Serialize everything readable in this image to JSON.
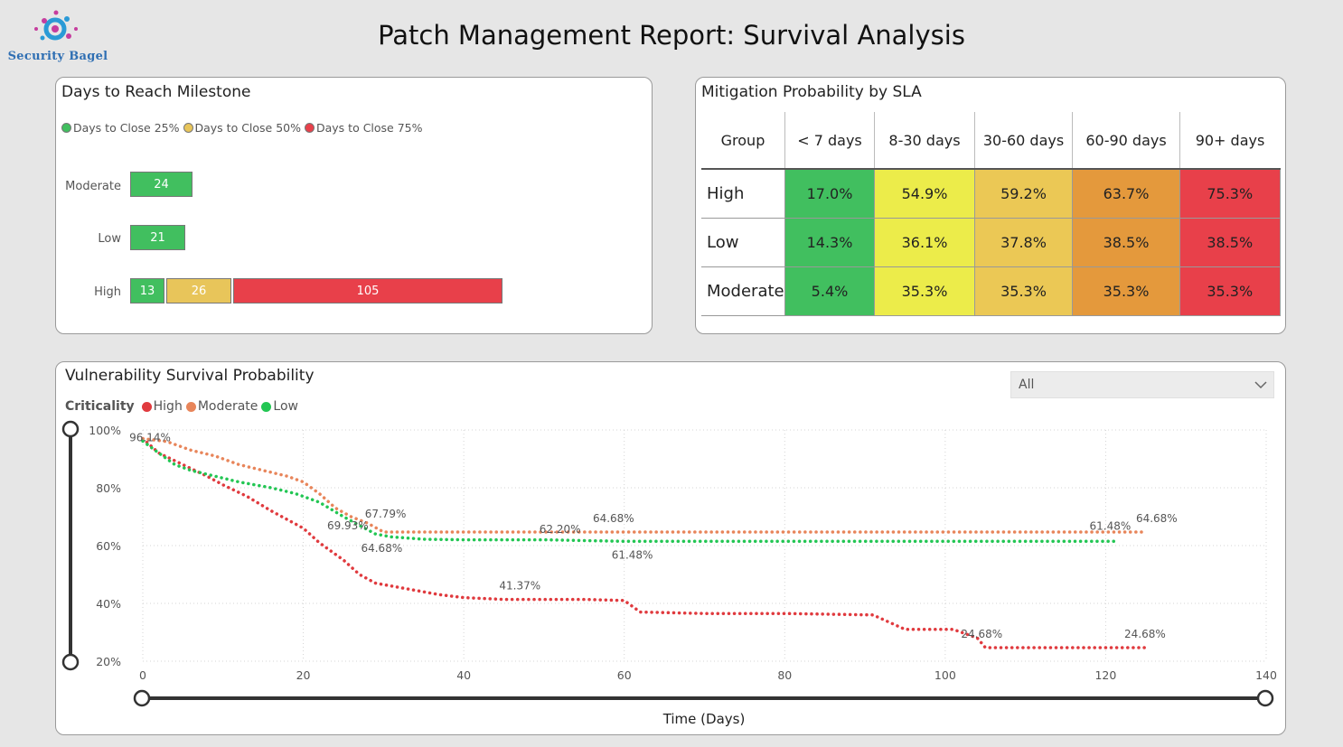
{
  "logo": {
    "text": "Security Bagel",
    "icon": "security-bagel-logo"
  },
  "page_title": "Patch Management Report: Survival Analysis",
  "milestone": {
    "title": "Days to Reach Milestone",
    "legend": [
      {
        "label": "Days to Close 25%",
        "color": "#41bf5f"
      },
      {
        "label": "Days to Close 50%",
        "color": "#e8c55a"
      },
      {
        "label": "Days to Close 75%",
        "color": "#e8404a"
      }
    ],
    "rows": [
      {
        "label": "Moderate",
        "values": [
          24
        ]
      },
      {
        "label": "Low",
        "values": [
          21
        ]
      },
      {
        "label": "High",
        "values": [
          13,
          26,
          105
        ]
      }
    ]
  },
  "sla": {
    "title": "Mitigation Probability by SLA",
    "columns": [
      "Group",
      "< 7 days",
      "8-30 days",
      "30-60 days",
      "60-90 days",
      "90+ days"
    ],
    "rows": [
      {
        "group": "High",
        "values": [
          "17.0%",
          "54.9%",
          "59.2%",
          "63.7%",
          "75.3%"
        ]
      },
      {
        "group": "Low",
        "values": [
          "14.3%",
          "36.1%",
          "37.8%",
          "38.5%",
          "38.5%"
        ]
      },
      {
        "group": "Moderate",
        "values": [
          "5.4%",
          "35.3%",
          "35.3%",
          "35.3%",
          "35.3%"
        ]
      }
    ],
    "column_colors": [
      "#41bf5f",
      "#ecec4a",
      "#ebc855",
      "#e4993c",
      "#e8404a"
    ]
  },
  "survival": {
    "title": "Vulnerability Survival Probability",
    "filter_value": "All",
    "legend_title": "Criticality",
    "legend": [
      {
        "label": "High",
        "color": "#e03a3e"
      },
      {
        "label": "Moderate",
        "color": "#e8855a"
      },
      {
        "label": "Low",
        "color": "#22c653"
      }
    ],
    "xlabel": "Time (Days)"
  },
  "chart_data": {
    "type": "line",
    "title": "Vulnerability Survival Probability",
    "xlabel": "Time (Days)",
    "ylabel": "",
    "xlim": [
      0,
      140
    ],
    "ylim": [
      20,
      100
    ],
    "x_ticks": [
      "0",
      "20",
      "40",
      "60",
      "80",
      "100",
      "120",
      "140"
    ],
    "y_ticks": [
      "20%",
      "40%",
      "60%",
      "80%",
      "100%"
    ],
    "grid": true,
    "legend_position": "top-left",
    "series": [
      {
        "name": "High",
        "color": "#e03a3e",
        "points": [
          [
            0,
            97
          ],
          [
            2,
            92
          ],
          [
            5,
            88
          ],
          [
            8,
            84
          ],
          [
            10,
            81
          ],
          [
            13,
            77
          ],
          [
            16,
            72
          ],
          [
            20,
            66
          ],
          [
            22,
            61
          ],
          [
            25,
            55
          ],
          [
            27,
            50
          ],
          [
            29,
            47
          ],
          [
            33,
            45
          ],
          [
            37,
            43
          ],
          [
            40,
            42
          ],
          [
            45,
            41.37
          ],
          [
            55,
            41.37
          ],
          [
            60,
            41
          ],
          [
            62,
            37
          ],
          [
            70,
            36.5
          ],
          [
            80,
            36.5
          ],
          [
            91,
            36
          ],
          [
            95,
            31
          ],
          [
            101,
            31
          ],
          [
            104,
            28
          ],
          [
            105,
            24.68
          ],
          [
            112,
            24.68
          ],
          [
            125,
            24.68
          ]
        ]
      },
      {
        "name": "Moderate",
        "color": "#e8855a",
        "points": [
          [
            0,
            97
          ],
          [
            3,
            96
          ],
          [
            6,
            93
          ],
          [
            9,
            91
          ],
          [
            12,
            88
          ],
          [
            15,
            86
          ],
          [
            18,
            84
          ],
          [
            20,
            82
          ],
          [
            22,
            78
          ],
          [
            24,
            73
          ],
          [
            26,
            69.93
          ],
          [
            28,
            67.79
          ],
          [
            30,
            64.68
          ],
          [
            40,
            64.68
          ],
          [
            50,
            64.68
          ],
          [
            55,
            64.68
          ],
          [
            62,
            64.68
          ],
          [
            80,
            64.68
          ],
          [
            100,
            64.68
          ],
          [
            120,
            64.68
          ],
          [
            125,
            64.68
          ]
        ]
      },
      {
        "name": "Low",
        "color": "#22c653",
        "points": [
          [
            0,
            96.14
          ],
          [
            2,
            92
          ],
          [
            4,
            88
          ],
          [
            6,
            86
          ],
          [
            9,
            84
          ],
          [
            12,
            82
          ],
          [
            16,
            80
          ],
          [
            19,
            78
          ],
          [
            22,
            75
          ],
          [
            25,
            70
          ],
          [
            27,
            67
          ],
          [
            29,
            64
          ],
          [
            31,
            63
          ],
          [
            35,
            62.2
          ],
          [
            40,
            62
          ],
          [
            50,
            62
          ],
          [
            60,
            61.48
          ],
          [
            80,
            61.48
          ],
          [
            100,
            61.48
          ],
          [
            120,
            61.48
          ],
          [
            121,
            61.48
          ]
        ]
      }
    ],
    "data_labels": [
      {
        "text": "96.14%",
        "x": 0,
        "y": 96.14
      },
      {
        "text": "67.79%",
        "x": 28,
        "y": 67.79
      },
      {
        "text": "69.93%",
        "x": 26,
        "y": 69.93
      },
      {
        "text": "64.68%",
        "x": 30,
        "y": 64.68
      },
      {
        "text": "62.20%",
        "x": 52,
        "y": 62.2
      },
      {
        "text": "64.68%",
        "x": 59,
        "y": 64.68
      },
      {
        "text": "61.48%",
        "x": 61,
        "y": 61.48
      },
      {
        "text": "41.37%",
        "x": 47,
        "y": 41.37
      },
      {
        "text": "61.48%",
        "x": 120,
        "y": 61.48
      },
      {
        "text": "64.68%",
        "x": 125,
        "y": 64.68
      },
      {
        "text": "24.68%",
        "x": 105,
        "y": 24.68
      },
      {
        "text": "24.68%",
        "x": 124,
        "y": 24.68
      }
    ]
  }
}
